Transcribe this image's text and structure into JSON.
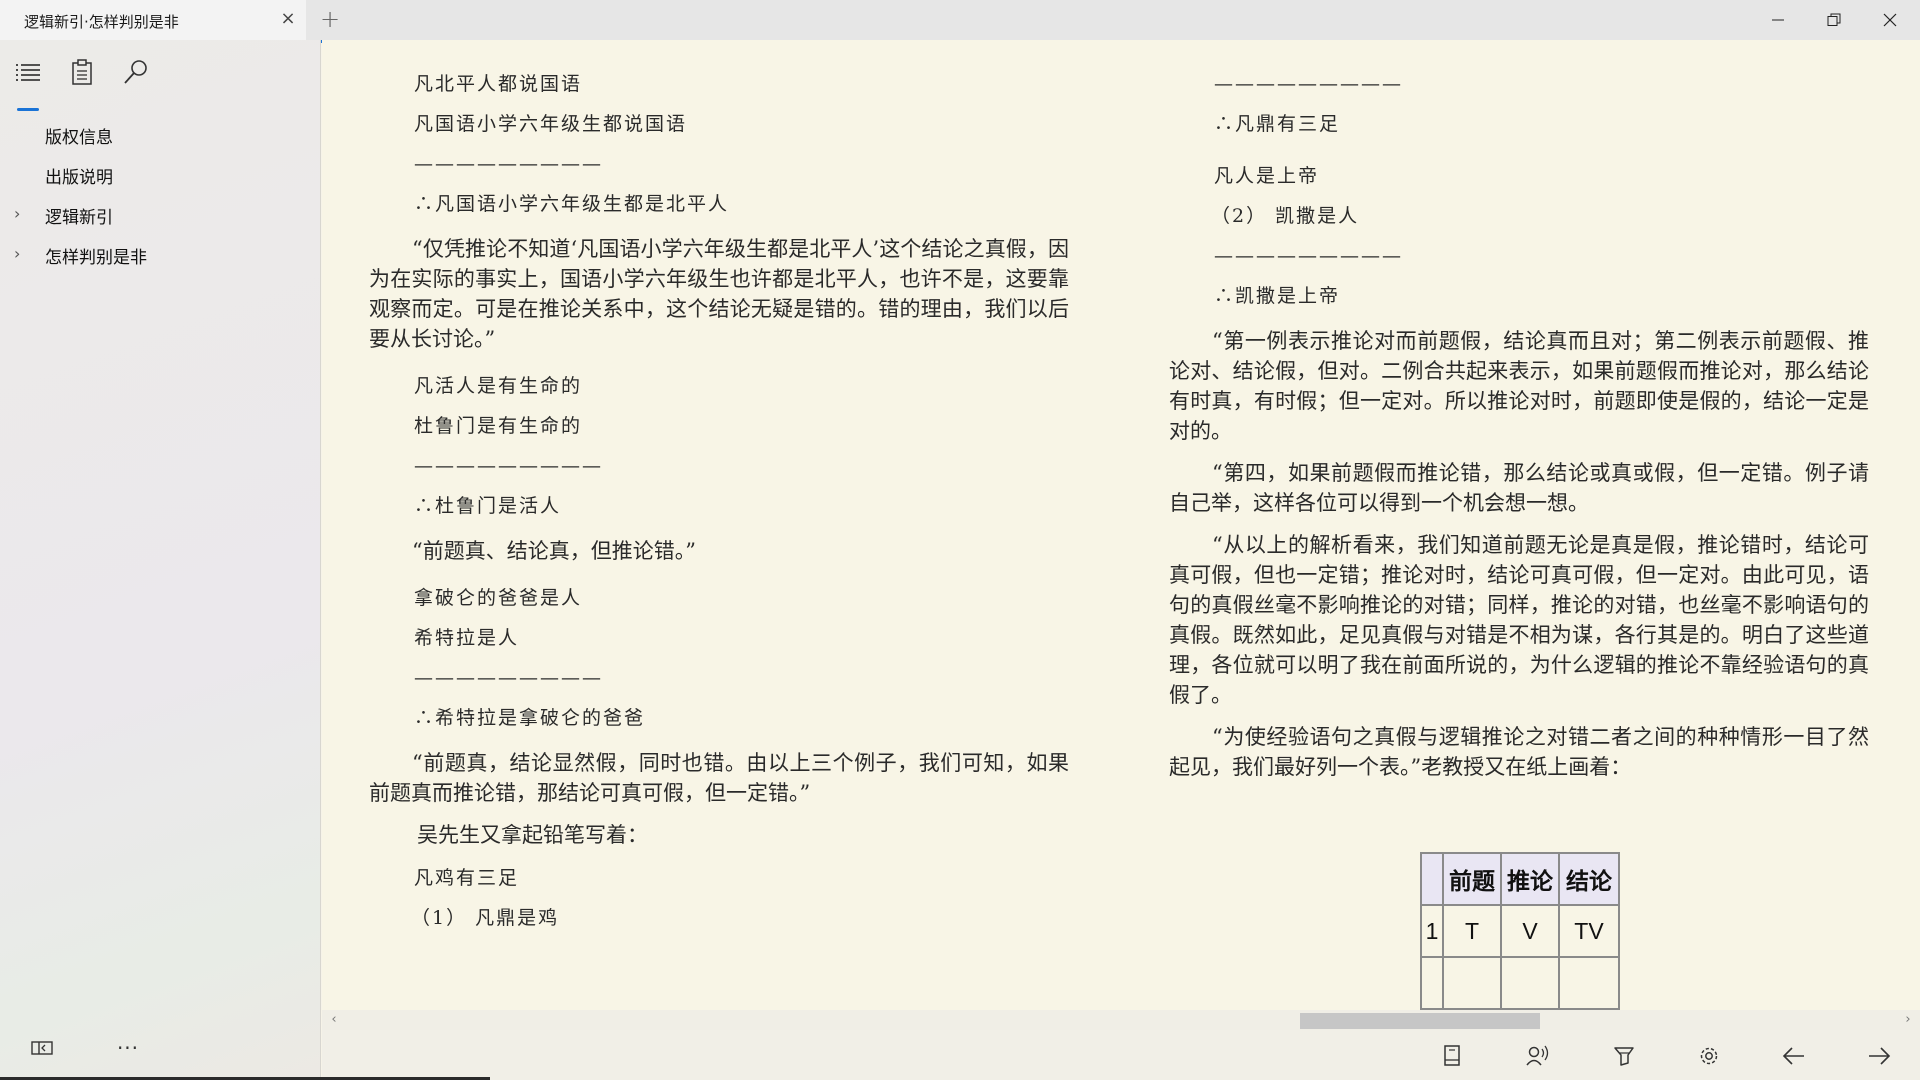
{
  "window": {
    "tab_title": "逻辑新引·怎样判别是非",
    "tab_close": "×",
    "tab_add": "+",
    "minimize": "─",
    "restore": "❐",
    "close": "✕"
  },
  "sidebar": {
    "tools": [
      "list-icon",
      "notes-icon",
      "search-icon"
    ],
    "toc": [
      {
        "label": "版权信息",
        "expandable": false
      },
      {
        "label": "出版说明",
        "expandable": false
      },
      {
        "label": "逻辑新引",
        "expandable": true
      },
      {
        "label": "怎样判别是非",
        "expandable": true
      }
    ],
    "chevron": "›",
    "more": "···"
  },
  "left_page": {
    "v1": [
      "凡北平人都说国语",
      "凡国语小学六年级生都说国语",
      "—————————",
      "∴凡国语小学六年级生都是北平人"
    ],
    "p1": "“仅凭推论不知道‘凡国语小学六年级生都是北平人’这个结论之真假，因为在实际的事实上，国语小学六年级生也许都是北平人，也许不是，这要靠观察而定。可是在推论关系中，这个结论无疑是错的。错的理由，我们以后要从长讨论。”",
    "v2": [
      "凡活人是有生命的",
      "杜鲁门是有生命的",
      "—————————",
      "∴杜鲁门是活人"
    ],
    "p2": "“前题真、结论真，但推论错。”",
    "v3": [
      "拿破仑的爸爸是人",
      "希特拉是人",
      "—————————",
      "∴希特拉是拿破仑的爸爸"
    ],
    "p3": "“前题真，结论显然假，同时也错。由以上三个例子，我们可知，如果前题真而推论错，那结论可真可假，但一定错。”",
    "intro": "吴先生又拿起铅笔写着：",
    "v4": [
      "凡鸡有三足",
      "（1） 凡鼎是鸡"
    ]
  },
  "right_page": {
    "v1": [
      "—————————",
      "∴凡鼎有三足"
    ],
    "v2": [
      "凡人是上帝",
      "（2） 凯撒是人",
      "—————————",
      "∴凯撒是上帝"
    ],
    "p1": "“第一例表示推论对而前题假，结论真而且对；第二例表示前题假、推论对、结论假，但对。二例合共起来表示，如果前题假而推论对，那么结论有时真，有时假；但一定对。所以推论对时，前题即使是假的，结论一定是对的。",
    "p2": "“第四，如果前题假而推论错，那么结论或真或假，但一定错。例子请自己举，这样各位可以得到一个机会想一想。",
    "p3": "“从以上的解析看来，我们知道前题无论是真是假，推论错时，结论可真可假，但也一定错；推论对时，结论可真可假，但一定对。由此可见，语句的真假丝毫不影响推论的对错；同样，推论的对错，也丝毫不影响语句的真假。既然如此，足见真假与对错是不相为谋，各行其是的。明白了这些道理，各位就可以明了我在前面所说的，为什么逻辑的推论不靠经验语句的真假了。",
    "p4": "“为使经验语句之真假与逻辑推论之对错二者之间的种种情形一目了然起见，我们最好列一个表。”老教授又在纸上画着：",
    "table": {
      "headers": [
        "",
        "前题",
        "推论",
        "结论"
      ],
      "rows": [
        [
          "1",
          "T",
          "V",
          "TV"
        ],
        [
          "",
          "",
          "",
          ""
        ]
      ]
    }
  },
  "scrollbar": {
    "left": "‹",
    "right": "›"
  },
  "toolbar": [
    "book-icon",
    "read-aloud-icon",
    "highlight-icon",
    "settings-icon",
    "back-arrow-icon",
    "forward-arrow-icon"
  ],
  "colors": {
    "accent": "#1a73d6",
    "page": "#f8f5e6"
  }
}
